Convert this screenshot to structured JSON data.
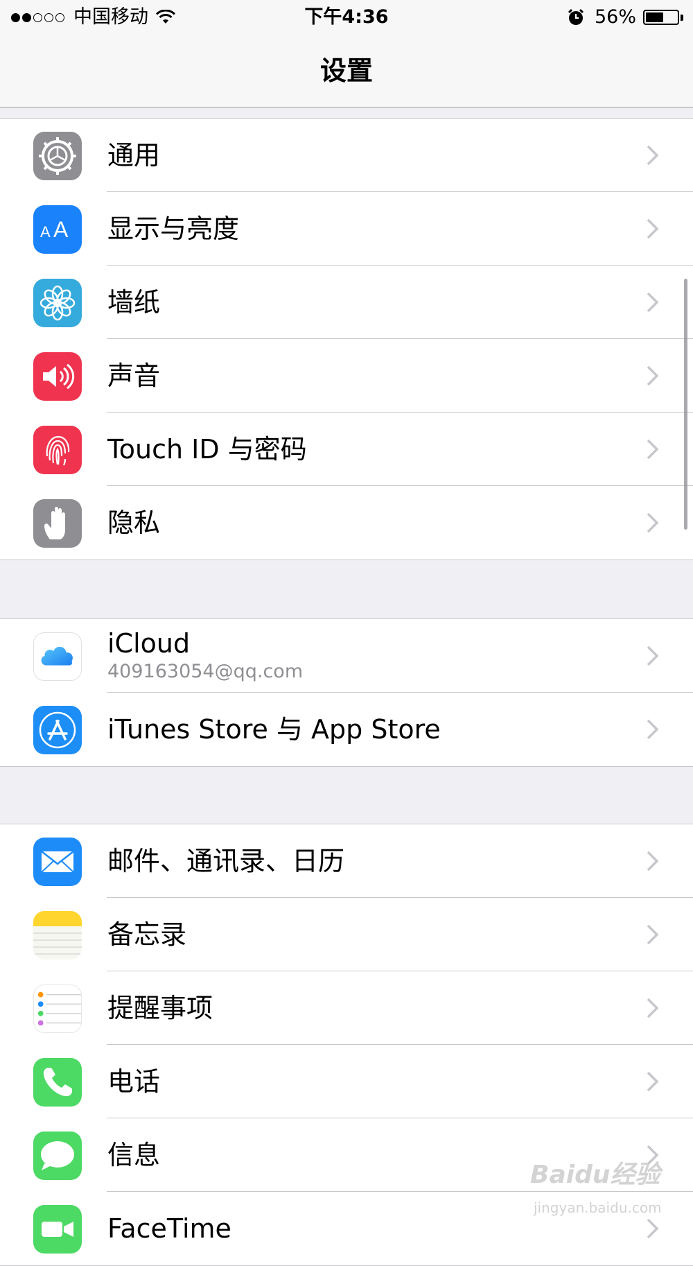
{
  "status_bar": {
    "carrier": "中国移动",
    "time": "下午4:36",
    "battery": "56%",
    "battery_level": 0.56,
    "signal_bars_filled": 2,
    "signal_bars_total": 5
  },
  "nav": {
    "title": "设置"
  },
  "groups": [
    {
      "items": [
        {
          "label": "通用",
          "icon": "gear-icon",
          "color": "#8e8e93"
        },
        {
          "label": "显示与亮度",
          "icon": "text-size-icon",
          "color": "#1a82fb"
        },
        {
          "label": "墙纸",
          "icon": "flower-icon",
          "color": "#35aadc"
        },
        {
          "label": "声音",
          "icon": "speaker-icon",
          "color": "#f0344f"
        },
        {
          "label": "Touch ID 与密码",
          "icon": "fingerprint-icon",
          "color": "#f0344f"
        },
        {
          "label": "隐私",
          "icon": "hand-icon",
          "color": "#8e8e93"
        }
      ]
    },
    {
      "items": [
        {
          "label": "iCloud",
          "sublabel": "409163054@qq.com",
          "icon": "cloud-icon",
          "color": "#ffffff"
        },
        {
          "label": "iTunes Store 与 App Store",
          "icon": "app-store-icon",
          "color": "#1c8ef5"
        }
      ]
    },
    {
      "items": [
        {
          "label": "邮件、通讯录、日历",
          "icon": "mail-icon",
          "color": "#1d8cf8"
        },
        {
          "label": "备忘录",
          "icon": "notes-icon",
          "color": "#ffd52e"
        },
        {
          "label": "提醒事项",
          "icon": "reminders-icon",
          "color": "#ffffff"
        },
        {
          "label": "电话",
          "icon": "phone-icon",
          "color": "#4cd964"
        },
        {
          "label": "信息",
          "icon": "messages-icon",
          "color": "#4cd964"
        },
        {
          "label": "FaceTime",
          "icon": "facetime-icon",
          "color": "#4cd964"
        }
      ]
    }
  ],
  "watermark": {
    "text": "Baidu经验",
    "sub": "jingyan.baidu.com"
  }
}
